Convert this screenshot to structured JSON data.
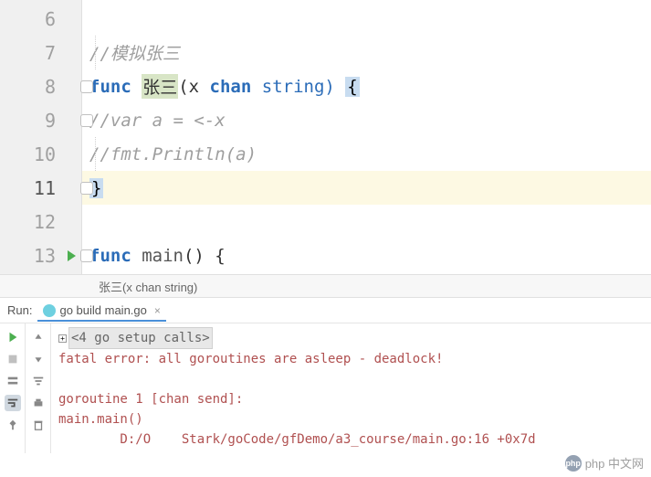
{
  "gutter": {
    "lines": [
      "6",
      "7",
      "8",
      "9",
      "10",
      "11",
      "12",
      "13"
    ],
    "current_line_index": 5
  },
  "code": {
    "line7_comment": "//模拟张三",
    "line8": {
      "keyword": "func ",
      "ident": "张三",
      "params_open": "(x ",
      "chan": "chan",
      "type": " string) ",
      "brace": "{"
    },
    "line9_comment": "//var a = <-x",
    "line10_comment": "//fmt.Println(a)",
    "line11_brace": "}",
    "line13": {
      "keyword": "func ",
      "name": "main",
      "rest": "() {"
    }
  },
  "breadcrumb": "张三(x chan string)",
  "run": {
    "label": "Run:",
    "tab_title": "go build main.go",
    "setup_calls": "<4 go setup calls>",
    "error_line": "fatal error: all goroutines are asleep - deadlock!",
    "goroutine": "goroutine 1 [chan send]:",
    "main_main": "main.main()",
    "trace": "        D:/O    Stark/goCode/gfDemo/a3_course/main.go:16 +0x7d"
  },
  "watermark": "php 中文网"
}
